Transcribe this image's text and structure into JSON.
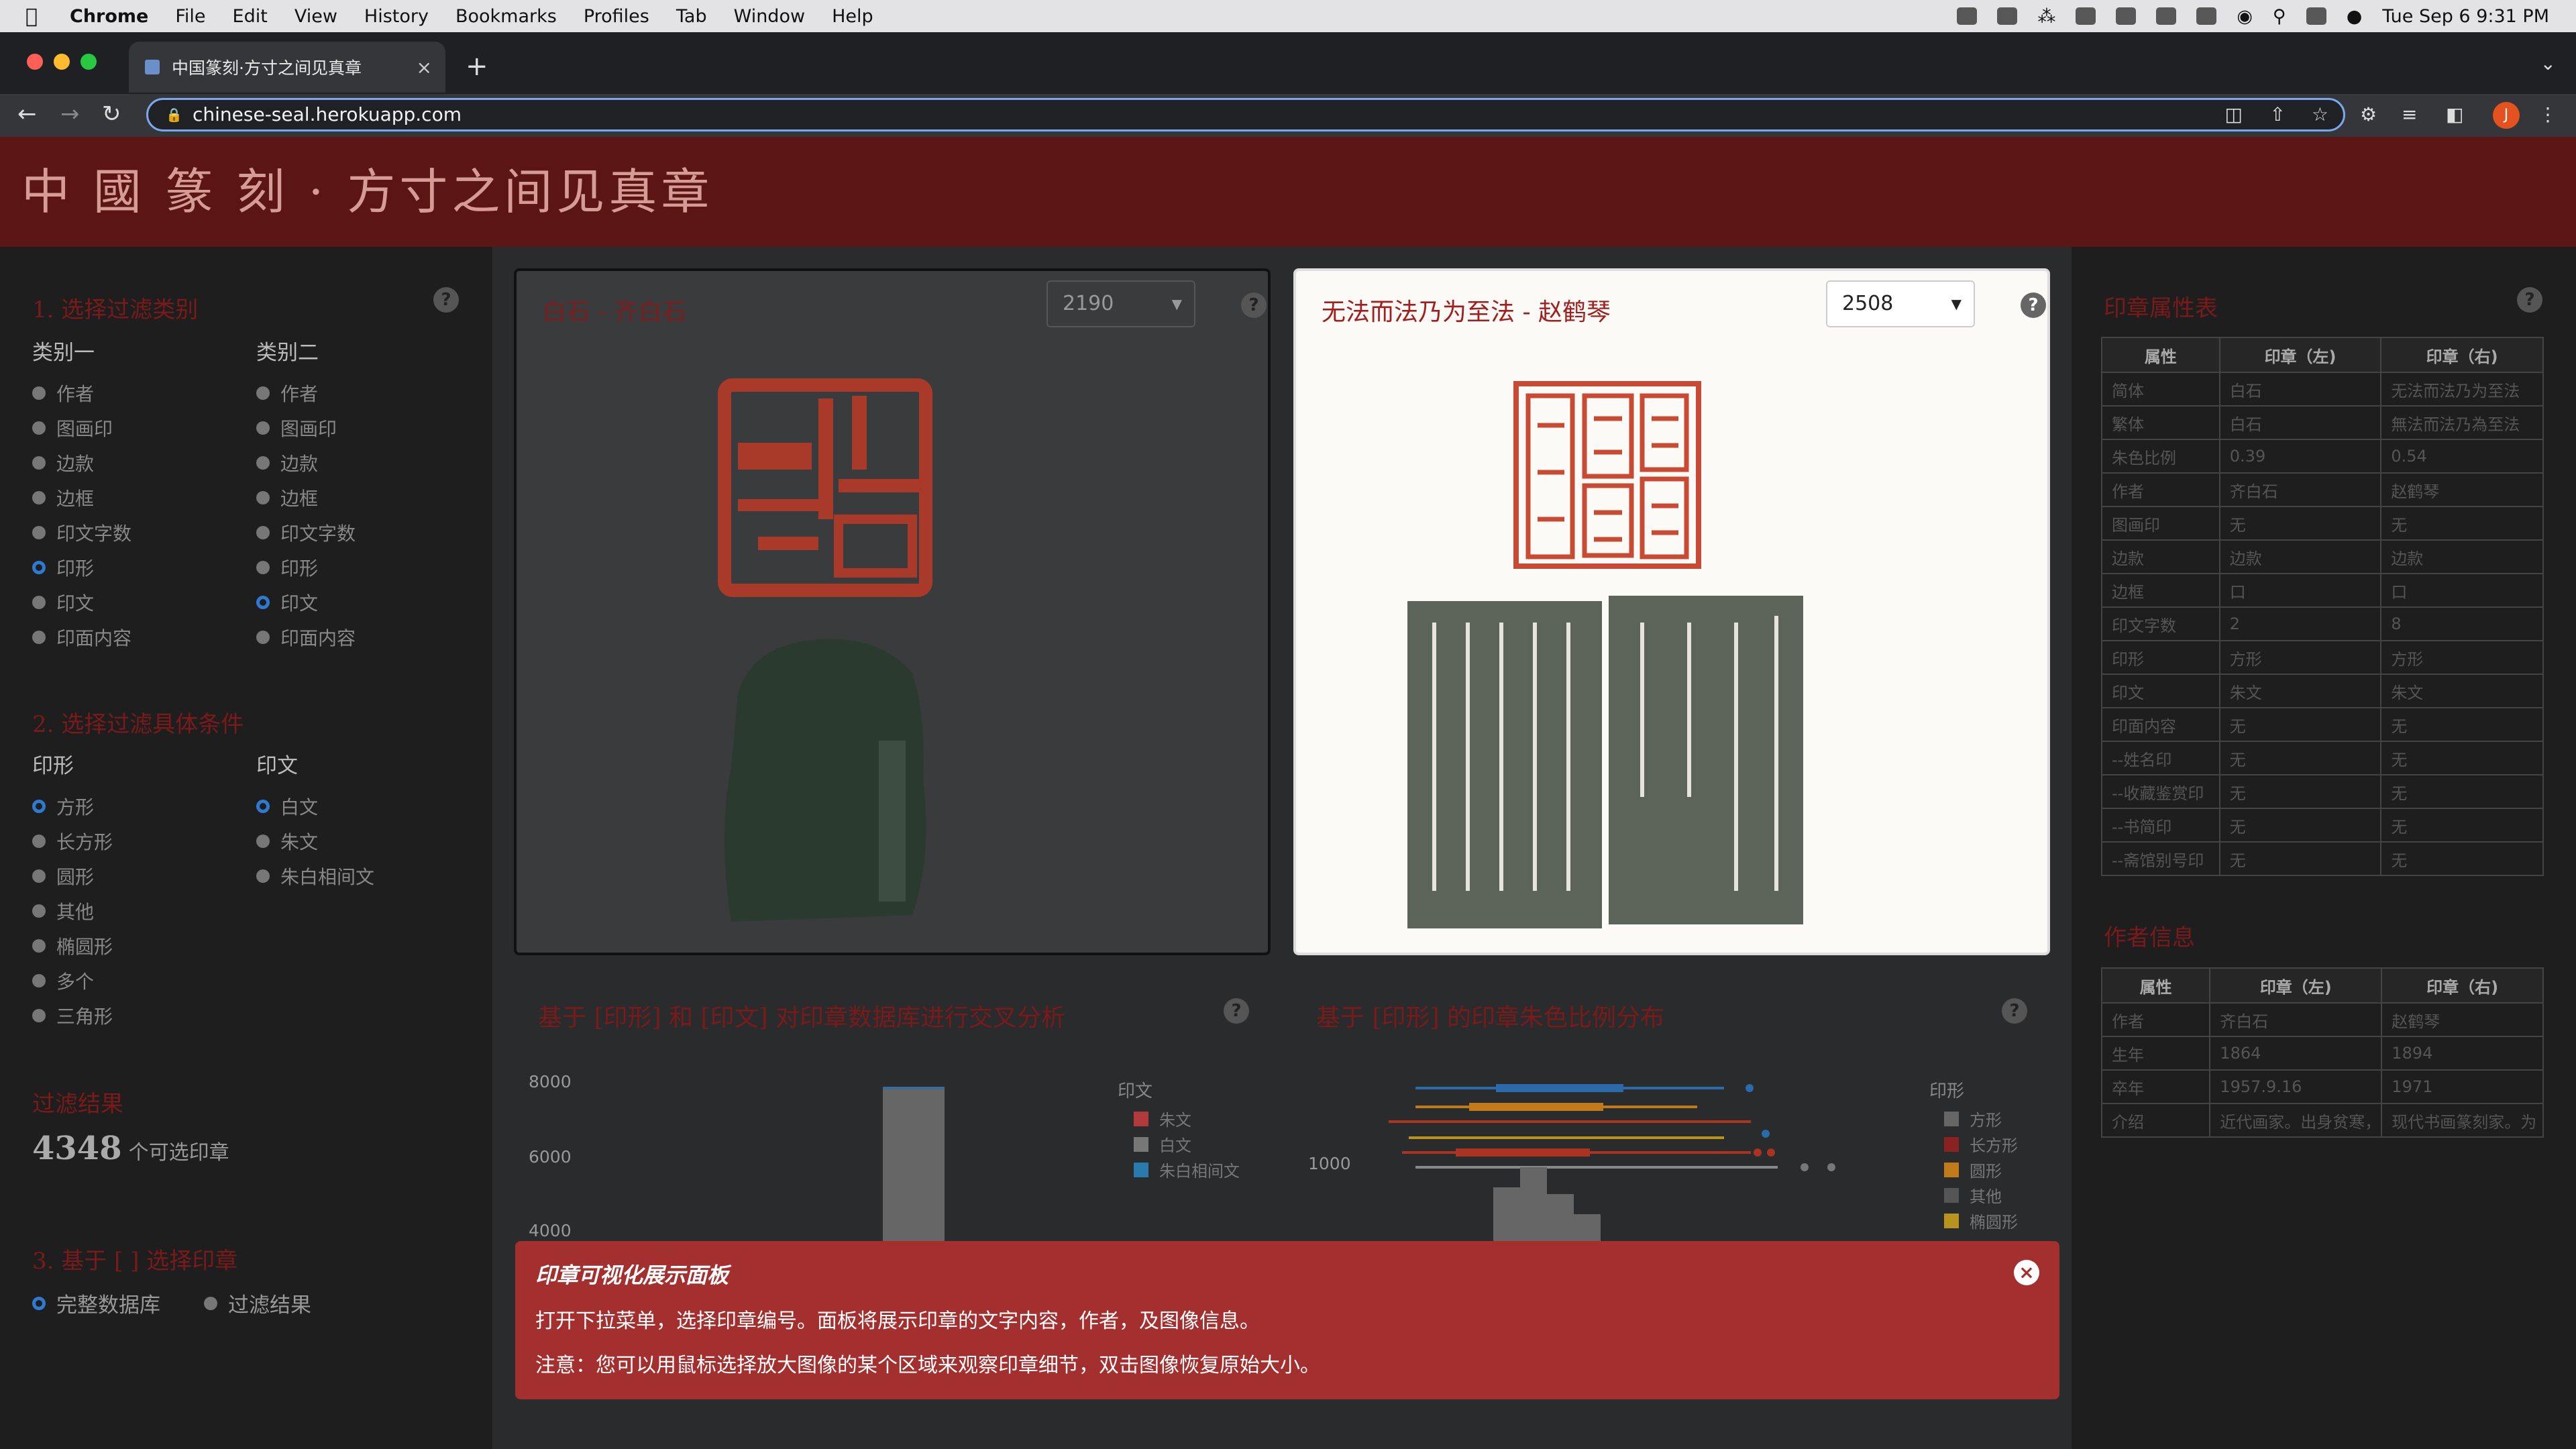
{
  "menubar": {
    "app": "Chrome",
    "items": [
      "File",
      "Edit",
      "View",
      "History",
      "Bookmarks",
      "Profiles",
      "Tab",
      "Window",
      "Help"
    ],
    "datetime": "Tue Sep 6  9:31 PM"
  },
  "browser": {
    "tab_title": "中国篆刻·方寸之间见真章",
    "url": "chinese-seal.herokuapp.com",
    "avatar": "J"
  },
  "page": {
    "banner_title": "中 國 篆 刻 · 方寸之间见真章",
    "left": {
      "section1": "1. 选择过滤类别",
      "col1_head": "类别一",
      "col2_head": "类别二",
      "categories": [
        "作者",
        "图画印",
        "边款",
        "边框",
        "印文字数",
        "印形",
        "印文",
        "印面内容"
      ],
      "col1_selected": "印形",
      "col2_selected": "印文",
      "section2": "2. 选择过滤具体条件",
      "shape_head": "印形",
      "text_head": "印文",
      "shapes": [
        "方形",
        "长方形",
        "圆形",
        "其他",
        "椭圆形",
        "多个",
        "三角形"
      ],
      "texts": [
        "白文",
        "朱文",
        "朱白相间文"
      ],
      "result_title": "过滤结果",
      "count": "4348",
      "count_suffix": "个可选印章",
      "section3": "3. 基于 [ ] 选择印章",
      "db_full": "完整数据库",
      "db_filtered": "过滤结果"
    },
    "cards": {
      "left_title": "白石 - 齐白石",
      "left_id": "2190",
      "right_title": "无法而法乃为至法 - 赵鹤琴",
      "right_id": "2508"
    },
    "chart1": {
      "title": "基于 [印形] 和 [印文] 对印章数据库进行交叉分析",
      "yticks": [
        "8000",
        "6000",
        "4000"
      ],
      "legend_title": "印文",
      "legend": [
        {
          "label": "朱文",
          "color": "#b33a3a"
        },
        {
          "label": "白文",
          "color": "#777777"
        },
        {
          "label": "朱白相间文",
          "color": "#2a7ab0"
        }
      ]
    },
    "chart2": {
      "title": "基于 [印形] 的印章朱色比例分布",
      "ytick": "1000",
      "legend_title": "印形",
      "legend": [
        {
          "label": "方形",
          "color": "#666666"
        },
        {
          "label": "长方形",
          "color": "#8a2222"
        },
        {
          "label": "圆形",
          "color": "#c07a1a"
        },
        {
          "label": "其他",
          "color": "#555555"
        },
        {
          "label": "椭圆形",
          "color": "#b8941f"
        }
      ]
    },
    "attr_title": "印章属性表",
    "attr_table": {
      "headers": [
        "属性",
        "印章（左)",
        "印章（右)"
      ],
      "rows": [
        [
          "简体",
          "白石",
          "无法而法乃为至法"
        ],
        [
          "繁体",
          "白石",
          "無法而法乃為至法"
        ],
        [
          "朱色比例",
          "0.39",
          "0.54"
        ],
        [
          "作者",
          "齐白石",
          "赵鹤琴"
        ],
        [
          "图画印",
          "无",
          "无"
        ],
        [
          "边款",
          "边款",
          "边款"
        ],
        [
          "边框",
          "口",
          "口"
        ],
        [
          "印文字数",
          "2",
          "8"
        ],
        [
          "印形",
          "方形",
          "方形"
        ],
        [
          "印文",
          "朱文",
          "朱文"
        ],
        [
          "印面内容",
          "无",
          "无"
        ],
        [
          "--姓名印",
          "无",
          "无"
        ],
        [
          "--收藏鉴赏印",
          "无",
          "无"
        ],
        [
          "--书简印",
          "无",
          "无"
        ],
        [
          "--斋馆别号印",
          "无",
          "无"
        ]
      ]
    },
    "author_title": "作者信息",
    "author_table": {
      "headers": [
        "属性",
        "印章（左)",
        "印章（右)"
      ],
      "rows": [
        [
          "作者",
          "齐白石",
          "赵鹤琴"
        ],
        [
          "生年",
          "1864",
          "1894"
        ],
        [
          "卒年",
          "1957.9.16",
          "1971"
        ],
        [
          "介绍",
          "近代画家。出身贫寒，",
          "现代书画篆刻家。为"
        ]
      ]
    },
    "alert": {
      "heading": "印章可视化展示面板",
      "line1": "打开下拉菜单，选择印章编号。面板将展示印章的文字内容，作者，及图像信息。",
      "line2": "注意：您可以用鼠标选择放大图像的某个区域来观察印章细节，双击图像恢复原始大小。"
    }
  }
}
